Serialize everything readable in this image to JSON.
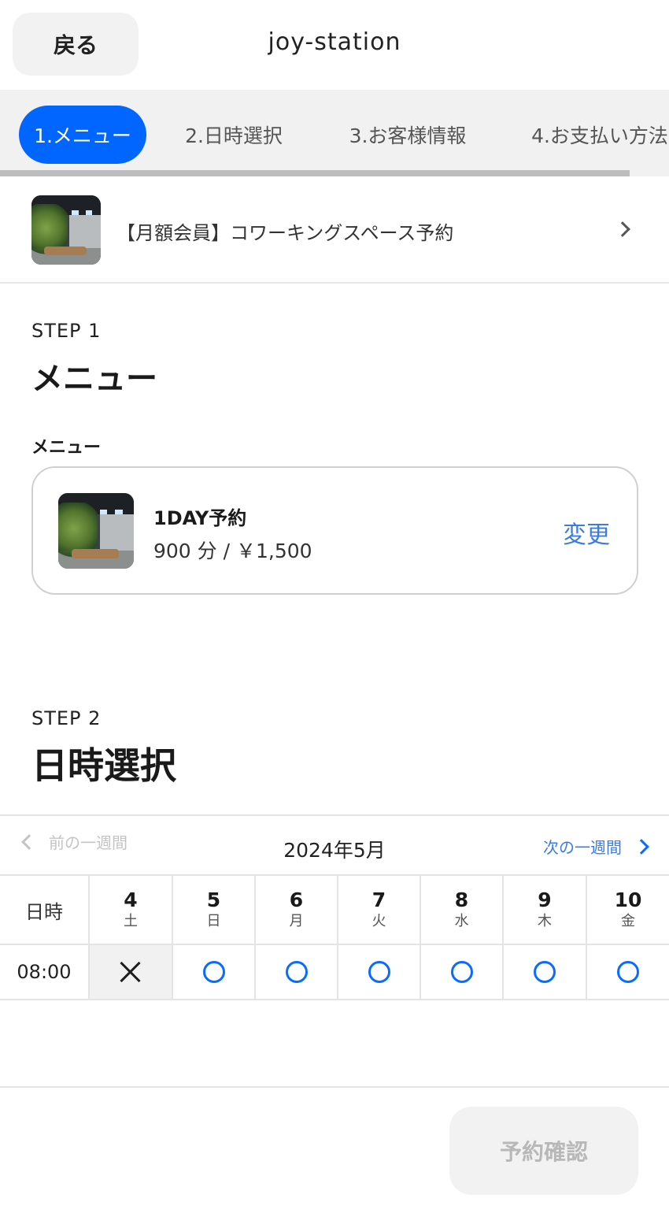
{
  "header": {
    "back_label": "戻る",
    "title": "joy-station"
  },
  "steps": [
    {
      "label": "1.メニュー",
      "active": true
    },
    {
      "label": "2.日時選択",
      "active": false
    },
    {
      "label": "3.お客様情報",
      "active": false
    },
    {
      "label": "4.お支払い方法",
      "active": false
    }
  ],
  "service": {
    "label": "【月額会員】コワーキングスペース予約"
  },
  "step1": {
    "step_label": "STEP 1",
    "heading": "メニュー",
    "field_label": "メニュー",
    "menu_item": {
      "title": "1DAY予約",
      "price": "900 分 / ￥1,500",
      "change_label": "変更"
    }
  },
  "step2": {
    "step_label": "STEP 2",
    "heading": "日時選択"
  },
  "calendar": {
    "prev_week": "前の一週間",
    "next_week": "次の一週間",
    "month": "2024年5月",
    "corner": "日時",
    "days": [
      {
        "num": "4",
        "weekday": "土"
      },
      {
        "num": "5",
        "weekday": "日"
      },
      {
        "num": "6",
        "weekday": "月"
      },
      {
        "num": "7",
        "weekday": "火"
      },
      {
        "num": "8",
        "weekday": "水"
      },
      {
        "num": "9",
        "weekday": "木"
      },
      {
        "num": "10",
        "weekday": "金"
      }
    ],
    "slots": [
      {
        "time": "08:00",
        "availability": [
          "×",
          "○",
          "○",
          "○",
          "○",
          "○",
          "○"
        ]
      }
    ]
  },
  "footer": {
    "confirm_label": "予約確認"
  },
  "colors": {
    "accent": "#0066ff",
    "link": "#3b7be8",
    "disabled_text": "#b8b8b8"
  }
}
